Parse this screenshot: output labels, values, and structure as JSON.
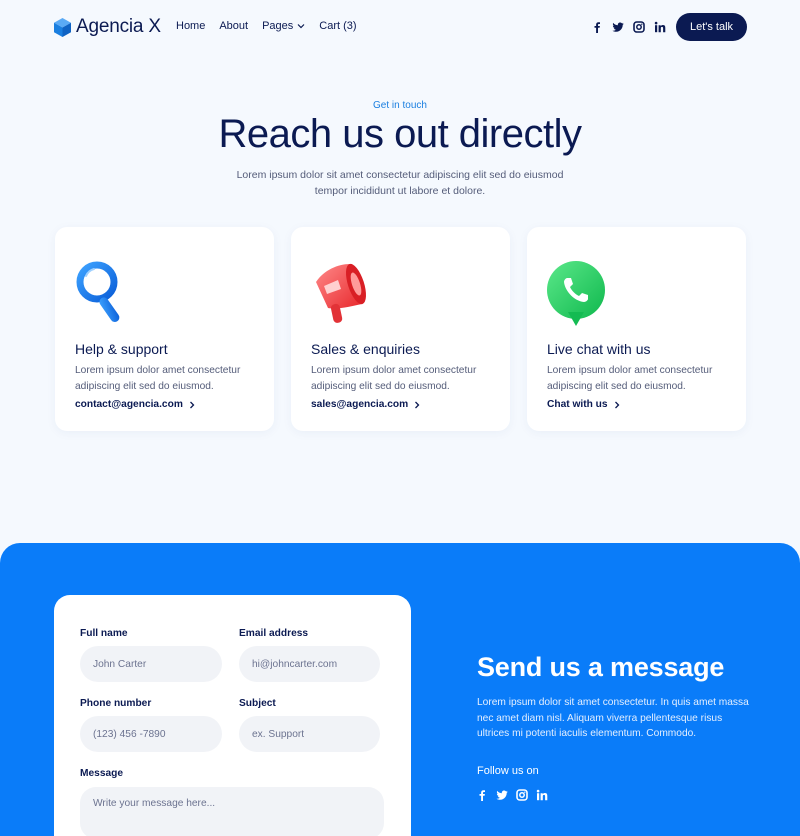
{
  "brand": {
    "name": "Agencia X",
    "color": "#1a7fe0",
    "dark": "#0b1a52"
  },
  "nav": {
    "items": [
      {
        "label": "Home"
      },
      {
        "label": "About"
      },
      {
        "label": "Pages"
      },
      {
        "label": "Cart (3)"
      }
    ],
    "socials": [
      "facebook-icon",
      "twitter-icon",
      "instagram-icon",
      "linkedin-icon"
    ],
    "cta_label": "Let's talk"
  },
  "hero": {
    "eyebrow": "Get in touch",
    "title": "Reach us out directly",
    "subtitle": "Lorem ipsum dolor sit amet consectetur adipiscing elit sed do eiusmod tempor incididunt ut labore et dolore."
  },
  "cards": [
    {
      "icon": "magnifier-icon",
      "title": "Help & support",
      "text": "Lorem ipsum dolor amet consectetur adipiscing elit sed do eiusmod.",
      "link": "contact@agencia.com"
    },
    {
      "icon": "megaphone-icon",
      "title": "Sales & enquiries",
      "text": "Lorem ipsum dolor amet consectetur adipiscing elit sed do eiusmod.",
      "link": "sales@agencia.com"
    },
    {
      "icon": "chat-phone-icon",
      "title": "Live chat with us",
      "text": "Lorem ipsum dolor amet consectetur adipiscing elit sed do eiusmod.",
      "link": "Chat with us"
    }
  ],
  "form": {
    "full_name": {
      "label": "Full name",
      "placeholder": "John Carter"
    },
    "email": {
      "label": "Email address",
      "placeholder": "hi@johncarter.com"
    },
    "phone": {
      "label": "Phone number",
      "placeholder": "(123) 456 -7890"
    },
    "subject": {
      "label": "Subject",
      "placeholder": "ex. Support"
    },
    "message": {
      "label": "Message",
      "placeholder": "Write your message here..."
    }
  },
  "message_section": {
    "title": "Send us a message",
    "text": "Lorem ipsum dolor sit amet consectetur. In quis amet massa nec amet diam nisl. Aliquam viverra pellentesque risus ultrices mi potenti iaculis elementum. Commodo.",
    "follow_label": "Follow us on",
    "accent": "#0a7cf9"
  }
}
